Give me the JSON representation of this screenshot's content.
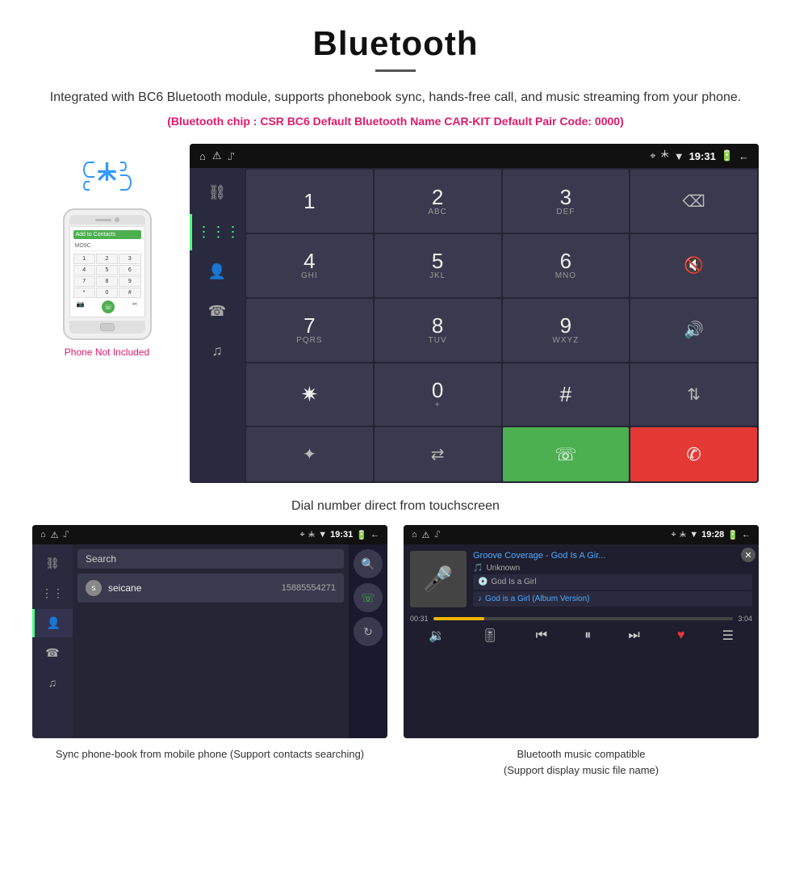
{
  "header": {
    "title": "Bluetooth",
    "description": "Integrated with BC6 Bluetooth module, supports phonebook sync, hands-free call, and music streaming from your phone.",
    "specs": "(Bluetooth chip : CSR BC6    Default Bluetooth Name CAR-KIT    Default Pair Code: 0000)"
  },
  "phone_side": {
    "not_included": "Phone Not Included",
    "keypad": [
      "1",
      "2",
      "3",
      "4",
      "5",
      "6",
      "7",
      "8",
      "9",
      "*",
      "0",
      "#"
    ]
  },
  "car_screen": {
    "status_time": "19:31",
    "dialpad": {
      "keys": [
        {
          "num": "1",
          "sub": ""
        },
        {
          "num": "2",
          "sub": "ABC"
        },
        {
          "num": "3",
          "sub": "DEF"
        },
        {
          "num": "⌫",
          "sub": ""
        },
        {
          "num": "4",
          "sub": "GHI"
        },
        {
          "num": "5",
          "sub": "JKL"
        },
        {
          "num": "6",
          "sub": "MNO"
        },
        {
          "num": "🎤",
          "sub": ""
        },
        {
          "num": "7",
          "sub": "PQRS"
        },
        {
          "num": "8",
          "sub": "TUV"
        },
        {
          "num": "9",
          "sub": "WXYZ"
        },
        {
          "num": "🔊",
          "sub": ""
        },
        {
          "num": "✱",
          "sub": ""
        },
        {
          "num": "0",
          "sub": "+"
        },
        {
          "num": "#",
          "sub": ""
        },
        {
          "num": "⇅",
          "sub": ""
        },
        {
          "num": "✦",
          "sub": ""
        },
        {
          "num": "⇆",
          "sub": ""
        },
        {
          "num": "📞",
          "sub": ""
        },
        {
          "num": "📵",
          "sub": ""
        }
      ]
    }
  },
  "main_caption": "Dial number direct from touchscreen",
  "phonebook_screen": {
    "status_time": "19:31",
    "search_placeholder": "Search",
    "contact": {
      "initial": "s",
      "name": "seicane",
      "number": "15885554271"
    }
  },
  "music_screen": {
    "status_time": "19:28",
    "title": "Groove Coverage - God Is A Gir...",
    "artist": "Unknown",
    "album": "God Is a Girl",
    "track": "God is a Girl (Album Version)",
    "progress_current": "00:31",
    "progress_total": "3:04",
    "progress_percent": 17
  },
  "bottom_captions": {
    "phonebook": "Sync phone-book from mobile phone\n(Support contacts searching)",
    "music": "Bluetooth music compatible\n(Support display music file name)"
  }
}
